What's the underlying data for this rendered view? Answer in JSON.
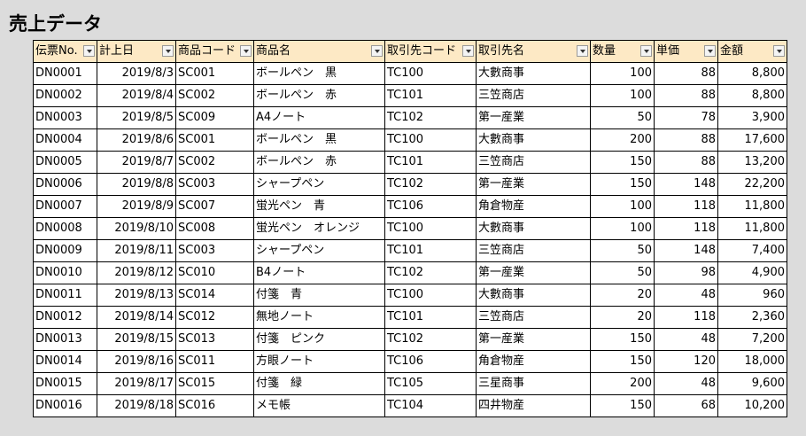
{
  "sheet": {
    "title": "売上データ"
  },
  "table": {
    "headers": [
      {
        "key": "slip_no",
        "label": "伝票No."
      },
      {
        "key": "date",
        "label": "計上日"
      },
      {
        "key": "product_code",
        "label": "商品コード"
      },
      {
        "key": "product_name",
        "label": "商品名"
      },
      {
        "key": "customer_code",
        "label": "取引先コード"
      },
      {
        "key": "customer_name",
        "label": "取引先名"
      },
      {
        "key": "quantity",
        "label": "数量"
      },
      {
        "key": "unit_price",
        "label": "単価"
      },
      {
        "key": "amount",
        "label": "金額"
      }
    ],
    "rows": [
      [
        "DN0001",
        "2019/8/3",
        "SC001",
        "ボールペン　黒",
        "TC100",
        "大數商事",
        "100",
        "88",
        "8,800"
      ],
      [
        "DN0002",
        "2019/8/4",
        "SC002",
        "ボールペン　赤",
        "TC101",
        "三笠商店",
        "100",
        "88",
        "8,800"
      ],
      [
        "DN0003",
        "2019/8/5",
        "SC009",
        "A4ノート",
        "TC102",
        "第一産業",
        "50",
        "78",
        "3,900"
      ],
      [
        "DN0004",
        "2019/8/6",
        "SC001",
        "ボールペン　黒",
        "TC100",
        "大數商事",
        "200",
        "88",
        "17,600"
      ],
      [
        "DN0005",
        "2019/8/7",
        "SC002",
        "ボールペン　赤",
        "TC101",
        "三笠商店",
        "150",
        "88",
        "13,200"
      ],
      [
        "DN0006",
        "2019/8/8",
        "SC003",
        "シャープペン",
        "TC102",
        "第一産業",
        "150",
        "148",
        "22,200"
      ],
      [
        "DN0007",
        "2019/8/9",
        "SC007",
        "蛍光ペン　青",
        "TC106",
        "角倉物産",
        "100",
        "118",
        "11,800"
      ],
      [
        "DN0008",
        "2019/8/10",
        "SC008",
        "蛍光ペン　オレンジ",
        "TC100",
        "大數商事",
        "100",
        "118",
        "11,800"
      ],
      [
        "DN0009",
        "2019/8/11",
        "SC003",
        "シャープペン",
        "TC101",
        "三笠商店",
        "50",
        "148",
        "7,400"
      ],
      [
        "DN0010",
        "2019/8/12",
        "SC010",
        "B4ノート",
        "TC102",
        "第一産業",
        "50",
        "98",
        "4,900"
      ],
      [
        "DN0011",
        "2019/8/13",
        "SC014",
        "付箋　青",
        "TC100",
        "大數商事",
        "20",
        "48",
        "960"
      ],
      [
        "DN0012",
        "2019/8/14",
        "SC012",
        "無地ノート",
        "TC101",
        "三笠商店",
        "20",
        "118",
        "2,360"
      ],
      [
        "DN0013",
        "2019/8/15",
        "SC013",
        "付箋　ピンク",
        "TC102",
        "第一産業",
        "150",
        "48",
        "7,200"
      ],
      [
        "DN0014",
        "2019/8/16",
        "SC011",
        "方眼ノート",
        "TC106",
        "角倉物産",
        "150",
        "120",
        "18,000"
      ],
      [
        "DN0015",
        "2019/8/17",
        "SC015",
        "付箋　緑",
        "TC105",
        "三星商事",
        "200",
        "48",
        "9,600"
      ],
      [
        "DN0016",
        "2019/8/18",
        "SC016",
        "メモ帳",
        "TC104",
        "四井物産",
        "150",
        "68",
        "10,200"
      ]
    ]
  }
}
